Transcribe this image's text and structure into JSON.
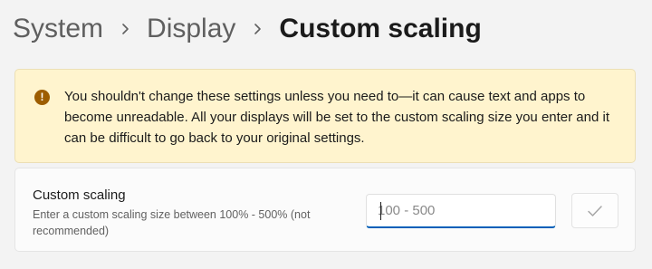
{
  "breadcrumb": {
    "items": [
      "System",
      "Display"
    ],
    "current": "Custom scaling"
  },
  "warning": {
    "icon": "warning-icon",
    "color": "#9d5d00",
    "background": "#fff4ce",
    "text": "You shouldn't change these settings unless you need to—it can cause text and apps to become unreadable. All your displays will be set to the custom scaling size you enter and it can be difficult to go back to your original settings."
  },
  "custom_scaling": {
    "title": "Custom scaling",
    "description": "Enter a custom scaling size between 100% - 500% (not recommended)",
    "input": {
      "value": "",
      "placeholder": "100 - 500"
    },
    "apply_button": {
      "icon": "checkmark-icon",
      "enabled": false
    }
  },
  "colors": {
    "accent": "#005fb8"
  }
}
